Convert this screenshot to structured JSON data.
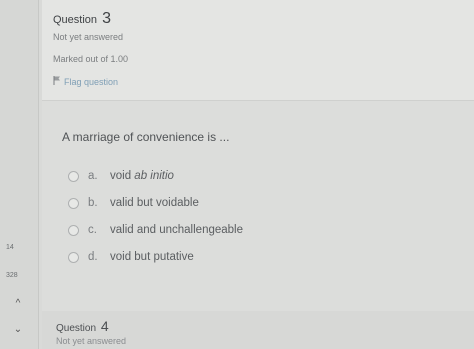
{
  "sidebar": {
    "num_a": "14",
    "num_b": "328",
    "chevron_up": "^",
    "chevron_down": "⌄"
  },
  "question": {
    "label": "Question",
    "number": "3",
    "state": "Not yet answered",
    "grade": "Marked out of 1.00",
    "flag_label": "Flag question",
    "text": "A marriage of convenience is ...",
    "options": [
      {
        "letter": "a.",
        "text_plain": "void ",
        "text_italic": "ab initio"
      },
      {
        "letter": "b.",
        "text_plain": "valid but voidable",
        "text_italic": ""
      },
      {
        "letter": "c.",
        "text_plain": "valid and unchallengeable",
        "text_italic": ""
      },
      {
        "letter": "d.",
        "text_plain": "void but putative",
        "text_italic": ""
      }
    ]
  },
  "next_question": {
    "label": "Question",
    "number": "4",
    "state": "Not yet answered"
  },
  "colors": {
    "page_bg": "#d9dad8",
    "flag_link": "#7f9fb6"
  },
  "icons": {
    "flag": "flag-icon",
    "radio": "radio-icon",
    "up": "chevron-up-icon",
    "down": "chevron-down-icon"
  }
}
